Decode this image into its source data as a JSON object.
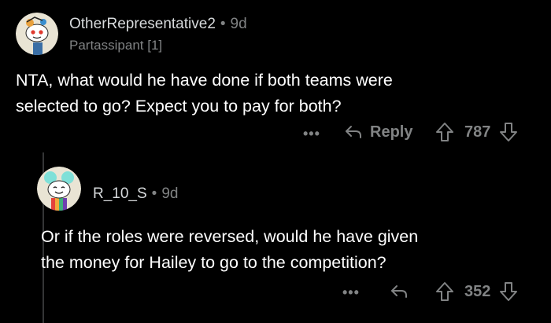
{
  "comment1": {
    "username": "OtherRepresentative2",
    "age": "9d",
    "flair": "Partassipant [1]",
    "body_line1": "NTA, what would he have done if both teams were",
    "body_line2": "selected to go? Expect you to pay for both?",
    "more": "•••",
    "reply_label": "Reply",
    "score": "787"
  },
  "comment2": {
    "username": "R_10_S",
    "age": "9d",
    "body_line1": "Or if the roles were reversed, would he have given",
    "body_line2": "the money for Hailey to go to the competition?",
    "more": "•••",
    "score": "352"
  },
  "separator": "•",
  "colors": {
    "background": "#000000",
    "text": "#ffffff",
    "muted": "#818384",
    "thread_line": "#343536"
  }
}
